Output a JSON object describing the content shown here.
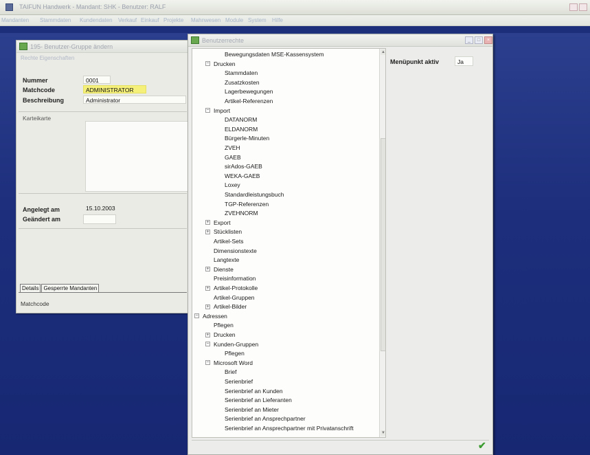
{
  "app": {
    "title": "TAIFUN Handwerk - Mandant: SHK - Benutzer: RALF",
    "menu": [
      "Mandanten",
      "Stammdaten",
      "Kundendaten",
      "Verkauf",
      "Einkauf",
      "Projekte",
      "Mahnwesen",
      "Module",
      "System",
      "Hilfe"
    ]
  },
  "group_dialog": {
    "title": "195- Benutzer-Gruppe ändern",
    "submenu": "Rechte   Eigenschaften",
    "nummer_label": "Nummer",
    "nummer_value": "0001",
    "matchcode_label": "Matchcode",
    "matchcode_value": "ADMINISTRATOR",
    "beschreibung_label": "Beschreibung",
    "beschreibung_value": "Administrator",
    "karteikarte_label": "Karteikarte",
    "angelegt_label": "Angelegt am",
    "angelegt_value": "15.10.2003",
    "geaendert_label": "Geändert am",
    "geaendert_value": "",
    "tabs": [
      "Details",
      "Gesperrte Mandanten"
    ],
    "status": "Matchcode"
  },
  "rights_dialog": {
    "title": "Benutzerrechte",
    "menu_active_label": "Menüpunkt aktiv",
    "menu_active_value": "Ja",
    "tree": [
      {
        "label": "Bewegungsdaten MSE-Kassensystem",
        "level": 3,
        "exp": ""
      },
      {
        "label": "Drucken",
        "level": 2,
        "exp": "-"
      },
      {
        "label": "Stammdaten",
        "level": 3,
        "exp": ""
      },
      {
        "label": "Zusatzkosten",
        "level": 3,
        "exp": ""
      },
      {
        "label": "Lagerbewegungen",
        "level": 3,
        "exp": ""
      },
      {
        "label": "Artikel-Referenzen",
        "level": 3,
        "exp": ""
      },
      {
        "label": "Import",
        "level": 2,
        "exp": "-"
      },
      {
        "label": "DATANORM",
        "level": 3,
        "exp": ""
      },
      {
        "label": "ELDANORM",
        "level": 3,
        "exp": ""
      },
      {
        "label": "Bürgerle-Minuten",
        "level": 3,
        "exp": ""
      },
      {
        "label": "ZVEH",
        "level": 3,
        "exp": ""
      },
      {
        "label": "GAEB",
        "level": 3,
        "exp": ""
      },
      {
        "label": "sirAdos-GAEB",
        "level": 3,
        "exp": ""
      },
      {
        "label": "WEKA-GAEB",
        "level": 3,
        "exp": ""
      },
      {
        "label": "Loxey",
        "level": 3,
        "exp": ""
      },
      {
        "label": "Standardleistungsbuch",
        "level": 3,
        "exp": ""
      },
      {
        "label": "TGP-Referenzen",
        "level": 3,
        "exp": ""
      },
      {
        "label": "ZVEHNORM",
        "level": 3,
        "exp": ""
      },
      {
        "label": "Export",
        "level": 2,
        "exp": "+"
      },
      {
        "label": "Stücklisten",
        "level": 2,
        "exp": "+"
      },
      {
        "label": "Artikel-Sets",
        "level": 2,
        "exp": ""
      },
      {
        "label": "Dimensionstexte",
        "level": 2,
        "exp": ""
      },
      {
        "label": "Langtexte",
        "level": 2,
        "exp": ""
      },
      {
        "label": "Dienste",
        "level": 2,
        "exp": "+"
      },
      {
        "label": "Preisinformation",
        "level": 2,
        "exp": ""
      },
      {
        "label": "Artikel-Protokolle",
        "level": 2,
        "exp": "+"
      },
      {
        "label": "Artikel-Gruppen",
        "level": 2,
        "exp": ""
      },
      {
        "label": "Artikel-Bilder",
        "level": 2,
        "exp": "+"
      },
      {
        "label": "Adressen",
        "level": 1,
        "exp": "-"
      },
      {
        "label": "Pflegen",
        "level": 2,
        "exp": ""
      },
      {
        "label": "Drucken",
        "level": 2,
        "exp": "+"
      },
      {
        "label": "Kunden-Gruppen",
        "level": 2,
        "exp": "-"
      },
      {
        "label": "Pflegen",
        "level": 3,
        "exp": ""
      },
      {
        "label": "Microsoft Word",
        "level": 2,
        "exp": "-"
      },
      {
        "label": "Brief",
        "level": 3,
        "exp": ""
      },
      {
        "label": "Serienbrief",
        "level": 3,
        "exp": ""
      },
      {
        "label": "Serienbrief an Kunden",
        "level": 3,
        "exp": ""
      },
      {
        "label": "Serienbrief an Lieferanten",
        "level": 3,
        "exp": ""
      },
      {
        "label": "Serienbrief an Mieter",
        "level": 3,
        "exp": ""
      },
      {
        "label": "Serienbrief an Ansprechpartner",
        "level": 3,
        "exp": ""
      },
      {
        "label": "Serienbrief an Ansprechpartner mit Privatanschrift",
        "level": 3,
        "exp": ""
      }
    ]
  },
  "colors": {
    "desktop": "#1c2e7a",
    "highlight": "#f5f07a",
    "confirm": "#3a9b2e"
  }
}
